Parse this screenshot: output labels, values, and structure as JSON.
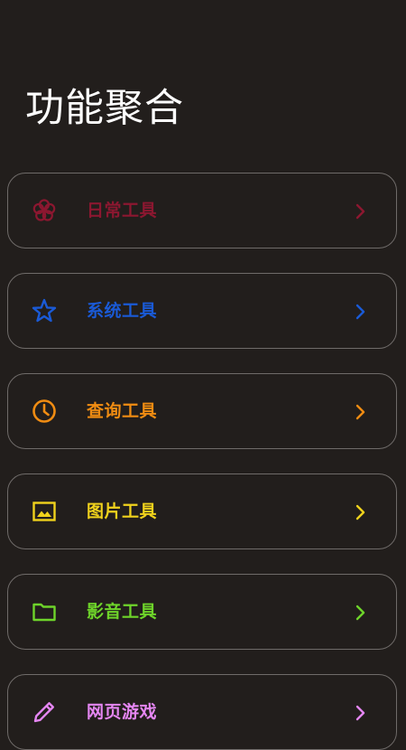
{
  "page": {
    "title": "功能聚合"
  },
  "menu": {
    "items": [
      {
        "label": "日常工具",
        "color": "#8c1730",
        "icon": "flower-icon"
      },
      {
        "label": "系统工具",
        "color": "#1a5ad6",
        "icon": "star-icon"
      },
      {
        "label": "查询工具",
        "color": "#f08c12",
        "icon": "clock-icon"
      },
      {
        "label": "图片工具",
        "color": "#f0d21c",
        "icon": "image-icon"
      },
      {
        "label": "影音工具",
        "color": "#6ed42a",
        "icon": "folder-icon"
      },
      {
        "label": "网页游戏",
        "color": "#e586f2",
        "icon": "pencil-icon"
      }
    ]
  }
}
